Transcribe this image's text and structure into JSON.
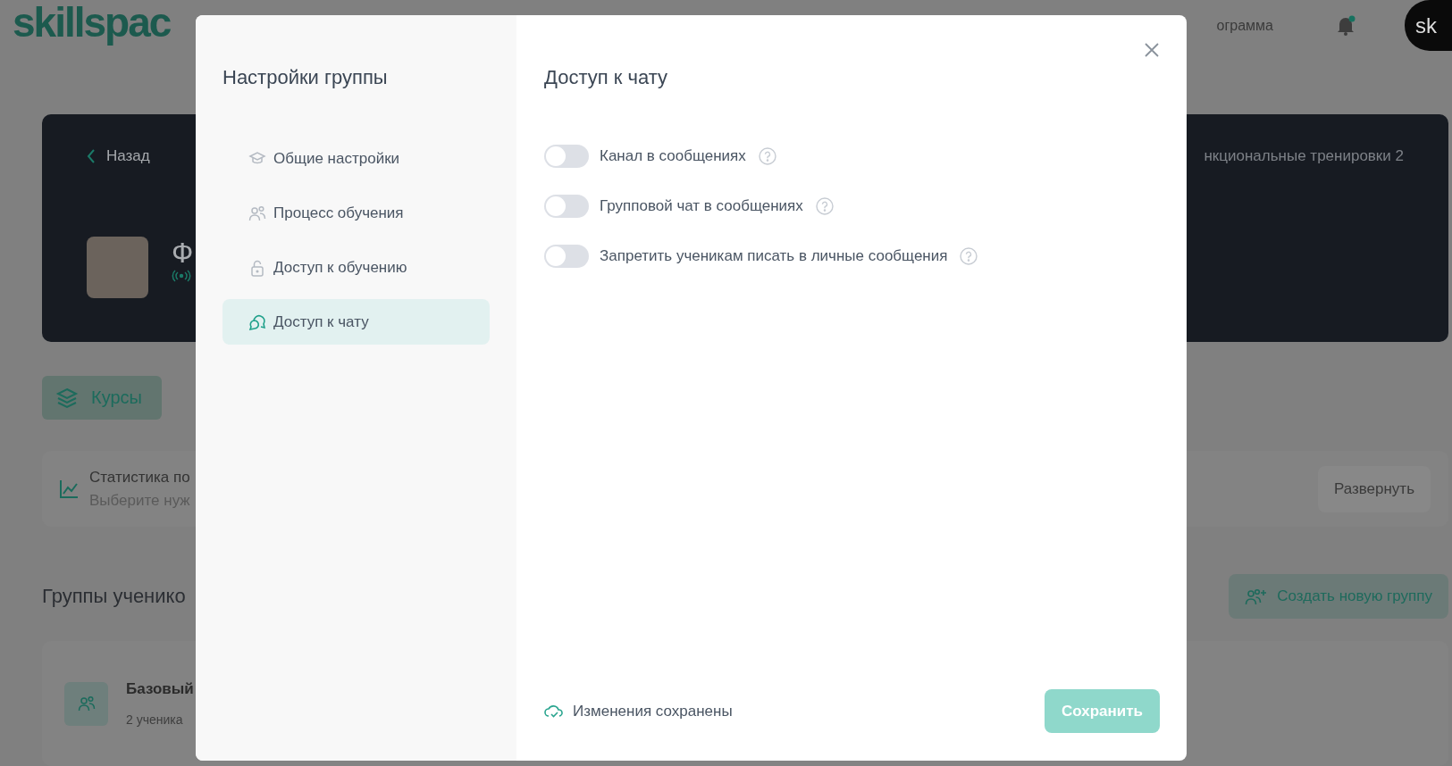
{
  "background_page": {
    "header": {
      "logo": "skillspac",
      "nav_link": "ограмма",
      "avatar": "sk"
    },
    "banner": {
      "back_link": "Назад",
      "course_title": "Ф",
      "breadcrumb": "нкциональные тренировки 2"
    },
    "tabs": [
      {
        "label": "Курсы",
        "selected": true
      }
    ],
    "stats_card": {
      "title": "Статистика по",
      "subtitle": "Выберите нуж",
      "expand_button": "Развернуть"
    },
    "groups": {
      "heading": "Группы ученико",
      "create_button": "Создать новую группу",
      "items": [
        {
          "name": "Базовый",
          "count": "2 ученика"
        }
      ]
    }
  },
  "modal": {
    "sidebar_title": "Настройки группы",
    "nav": [
      {
        "kind": "cap",
        "label": "Общие настройки",
        "selected": false
      },
      {
        "kind": "people",
        "label": "Процесс обучения",
        "selected": false
      },
      {
        "kind": "lock",
        "label": "Доступ к обучению",
        "selected": false
      },
      {
        "kind": "chat",
        "label": "Доступ к чату",
        "selected": true
      }
    ],
    "title": "Доступ к чату",
    "toggles": [
      {
        "label": "Канал в сообщениях",
        "on": false
      },
      {
        "label": "Групповой чат в сообщениях",
        "on": false
      },
      {
        "label": "Запретить ученикам писать в личные сообщения",
        "on": false
      }
    ],
    "status": "Изменения сохранены",
    "save_button": {
      "label": "Сохранить",
      "disabled": true
    }
  }
}
